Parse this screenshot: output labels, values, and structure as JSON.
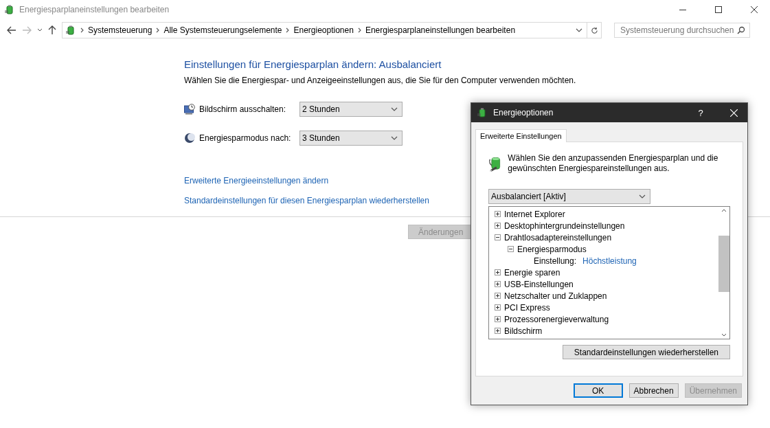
{
  "window": {
    "title": "Energiesparplaneinstellungen bearbeiten"
  },
  "navigation": {
    "back": {
      "disabled": false
    },
    "forward": {
      "disabled": true
    }
  },
  "address_bar": {
    "breadcrumbs": [
      "Systemsteuerung",
      "Alle Systemsteuerungselemente",
      "Energieoptionen",
      "Energiesparplaneinstellungen bearbeiten"
    ],
    "search": {
      "placeholder": "Systemsteuerung durchsuchen"
    }
  },
  "page": {
    "heading": "Einstellungen für Energiesparplan ändern: Ausbalanciert",
    "description": "Wählen Sie die Energiespar- und Anzeigeeinstellungen aus, die Sie für den Computer verwenden möchten.",
    "settings": [
      {
        "kind": "display",
        "label": "Bildschirm ausschalten:",
        "value": "2 Stunden"
      },
      {
        "kind": "sleep",
        "label": "Energiesparmodus nach:",
        "value": "3 Stunden"
      }
    ],
    "links": [
      "Erweiterte Energieeinstellungen ändern",
      "Standardeinstellungen für diesen Energiesparplan wiederherstellen"
    ],
    "buttons": [
      {
        "label": "Änderungen",
        "disabled": true
      }
    ]
  },
  "dialog": {
    "title": "Energieoptionen",
    "help": "?",
    "tabs": [
      {
        "label": "Erweiterte Einstellungen",
        "selected": true
      }
    ],
    "description": "Wählen Sie den anzupassenden Energiesparplan und die gewünschten Energiespareinstellungen aus.",
    "plan": {
      "value": "Ausbalanciert [Aktiv]"
    },
    "tree": [
      {
        "kind": "group",
        "label": "Internet Explorer",
        "expanded": false
      },
      {
        "kind": "group",
        "label": "Desktophintergrundeinstellungen",
        "expanded": false
      },
      {
        "kind": "group",
        "label": "Drahtlosadaptereinstellungen",
        "expanded": true,
        "children": [
          {
            "kind": "group",
            "label": "Energiesparmodus",
            "expanded": true,
            "children": [
              {
                "kind": "setting",
                "label": "Einstellung:",
                "value": "Höchstleistung"
              }
            ]
          }
        ]
      },
      {
        "kind": "group",
        "label": "Energie sparen",
        "expanded": false
      },
      {
        "kind": "group",
        "label": "USB-Einstellungen",
        "expanded": false
      },
      {
        "kind": "group",
        "label": "Netzschalter und Zuklappen",
        "expanded": false
      },
      {
        "kind": "group",
        "label": "PCI Express",
        "expanded": false
      },
      {
        "kind": "group",
        "label": "Prozessorenergieverwaltung",
        "expanded": false
      },
      {
        "kind": "group",
        "label": "Bildschirm",
        "expanded": false
      }
    ],
    "restore_button": "Standardeinstellungen wiederherstellen",
    "buttons": [
      {
        "label": "OK",
        "default": true,
        "disabled": false
      },
      {
        "label": "Abbrechen",
        "default": false,
        "disabled": false
      },
      {
        "label": "Übernehmen",
        "default": false,
        "disabled": true
      }
    ]
  }
}
